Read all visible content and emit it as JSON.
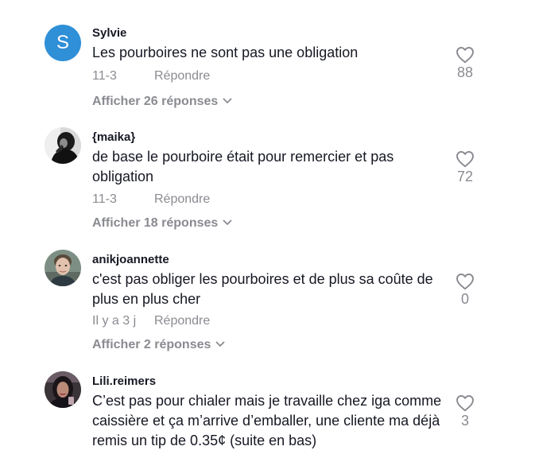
{
  "comments": [
    {
      "username": "Sylvie",
      "avatar_letter": "S",
      "text": "Les pourboires ne sont pas une obligation",
      "date": "11-3",
      "reply_label": "Répondre",
      "view_replies": "Afficher 26 réponses",
      "likes": "88"
    },
    {
      "username": "{maika}",
      "text": "de base le pourboire était pour remercier et pas obligation",
      "date": "11-3",
      "reply_label": "Répondre",
      "view_replies": "Afficher 18 réponses",
      "likes": "72"
    },
    {
      "username": "anikjoannette",
      "text": "c'est pas obliger les pourboires et de plus sa coûte de plus en plus cher",
      "date": "Il y a 3 j",
      "reply_label": "Répondre",
      "view_replies": "Afficher 2 réponses",
      "likes": "0"
    },
    {
      "username": "Lili.reimers",
      "text": "C’est pas pour chialer mais je travaille chez iga comme caissière et ça m’arrive d’emballer, une cliente ma déjà remis un tip de 0.35¢ (suite en bas)",
      "likes": "3"
    }
  ],
  "colors": {
    "primary_text": "#161823",
    "secondary_text": "#8a8b91",
    "avatar_blue": "#2f8fd7"
  },
  "icons": {
    "like": "heart-outline-icon",
    "expand": "chevron-down-icon"
  }
}
